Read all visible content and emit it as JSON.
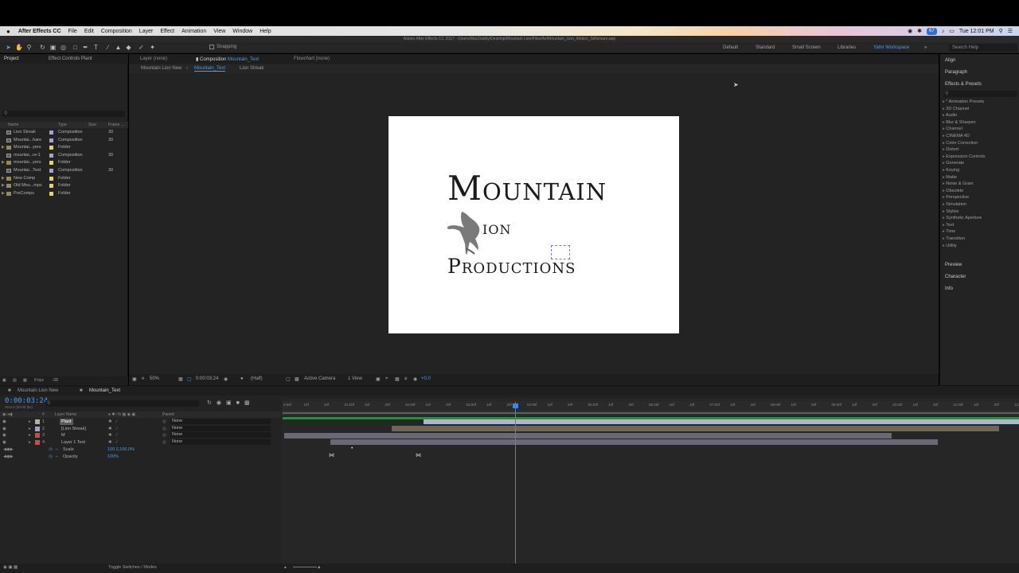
{
  "menubar": {
    "app": "After Effects CC",
    "items": [
      "File",
      "Edit",
      "Composition",
      "Layer",
      "Effect",
      "Animation",
      "View",
      "Window",
      "Help"
    ],
    "status_badge": "67",
    "clock": "Tue 12:01 PM"
  },
  "titlebar": "Adobe After Effects CC 2017 - /Users/MacDaddy/Desktop/Mountain Lion/Files/Ae/Mountain_Lion_Motion_Stillsmare.aep",
  "toolbar": {
    "snapping_label": "Snapping",
    "workspaces": [
      "Default",
      "Standard",
      "Small Screen",
      "Libraries",
      "Yahir Workspace"
    ],
    "active_workspace": "Yahir Workspace",
    "search_help_placeholder": "Search Help"
  },
  "project": {
    "tab_project": "Project",
    "tab_effect_controls": "Effect Controls Plant",
    "search_placeholder": "",
    "headers": {
      "name": "Name",
      "type": "Type",
      "size": "Size",
      "frame": "Frame ..."
    },
    "rows": [
      {
        "name": "Lion Streak",
        "type": "Composition",
        "frame": "30",
        "label_color": "#a5a3c8",
        "folder": false,
        "expand": false
      },
      {
        "name": "Mountai...hare",
        "type": "Composition",
        "frame": "30",
        "label_color": "#a5a3c8",
        "folder": false,
        "expand": false
      },
      {
        "name": "Mountai...yers",
        "type": "Folder",
        "frame": "",
        "label_color": "#e6d36b",
        "folder": true,
        "expand": true
      },
      {
        "name": "mountai...re-1",
        "type": "Composition",
        "frame": "30",
        "label_color": "#a5a3c8",
        "folder": false,
        "expand": false
      },
      {
        "name": "mountai...yers",
        "type": "Folder",
        "frame": "",
        "label_color": "#e6d36b",
        "folder": true,
        "expand": true
      },
      {
        "name": "Mountai...Text",
        "type": "Composition",
        "frame": "30",
        "label_color": "#a5a3c8",
        "folder": false,
        "expand": false
      },
      {
        "name": "New Comp",
        "type": "Folder",
        "frame": "",
        "label_color": "#e6d36b",
        "folder": true,
        "expand": true
      },
      {
        "name": "Old Mou...mps",
        "type": "Folder",
        "frame": "",
        "label_color": "#e6d36b",
        "folder": true,
        "expand": true
      },
      {
        "name": "PreComps",
        "type": "Folder",
        "frame": "",
        "label_color": "#e6d36b",
        "folder": true,
        "expand": true
      }
    ],
    "footer_bpc": "8 bpc"
  },
  "composition": {
    "tab_layer": "Layer (none)",
    "tab_comp_prefix": "Composition",
    "tab_comp_name": "Mountain_Text",
    "tab_flowchart": "Flowchart (none)",
    "nav": [
      "Mountain Lion New",
      "Mountain_Text",
      "Lion Streak"
    ],
    "nav_active": "Mountain_Text",
    "logo": {
      "line1": "Mountain",
      "line2": "ion",
      "line3": "Productions"
    },
    "footer": {
      "zoom": "50%",
      "timecode": "0:00:03:24",
      "resolution": "(Half)",
      "camera": "Active Camera",
      "views": "1 View",
      "exposure": "+0.0"
    }
  },
  "right": {
    "align": "Align",
    "paragraph": "Paragraph",
    "effects": "Effects & Presets",
    "search_placeholder": "",
    "effect_items": [
      "* Animation Presets",
      "3D Channel",
      "Audio",
      "Blur & Sharpen",
      "Channel",
      "CINEMA 4D",
      "Color Correction",
      "Distort",
      "Expression Controls",
      "Generate",
      "Keying",
      "Matte",
      "Noise & Grain",
      "Obsolete",
      "Perspective",
      "Simulation",
      "Stylize",
      "Synthetic Aperture",
      "Text",
      "Time",
      "Transition",
      "Utility"
    ],
    "preview": "Preview",
    "character": "Character",
    "info": "Info"
  },
  "timeline": {
    "tabs": [
      "Mountain Lion New",
      "Mountain_Text"
    ],
    "active_tab": "Mountain_Text",
    "timecode": "0:00:03:24",
    "timecode_sub": "00114 (30.00 fps)",
    "search_placeholder": "",
    "headers": {
      "layer_name": "Layer Name",
      "parent": "Parent"
    },
    "layers": [
      {
        "num": "1",
        "name": "Plant",
        "parent": "None",
        "color": "#b0b0b0",
        "selected": true
      },
      {
        "num": "2",
        "name": "[Lion Streak]",
        "parent": "None",
        "color": "#a5a3c8",
        "selected": false
      },
      {
        "num": "3",
        "name": "M",
        "parent": "None",
        "color": "#c05050",
        "selected": false
      },
      {
        "num": "4",
        "name": "Layer 1 Text",
        "parent": "None",
        "color": "#c05050",
        "selected": false
      }
    ],
    "properties": [
      {
        "name": "Scale",
        "value": "100.0,100.0%"
      },
      {
        "name": "Opacity",
        "value": "100%"
      }
    ],
    "ruler_labels": [
      "0:00f",
      "10f",
      "20f",
      "01:00f",
      "10f",
      "20f",
      "02:00f",
      "10f",
      "20f",
      "03:00f",
      "10f",
      "20f",
      "04:00f",
      "10f",
      "20f",
      "05:00f",
      "10f",
      "20f",
      "06:00f",
      "10f",
      "20f",
      "07:00f",
      "10f",
      "20f",
      "08:00f",
      "10f",
      "20f",
      "09:00f",
      "10f",
      "20f",
      "10:00f",
      "10f",
      "20f",
      "11:00f",
      "10f",
      "20f",
      "12:00"
    ],
    "footer_toggle": "Toggle Switches / Modes"
  }
}
